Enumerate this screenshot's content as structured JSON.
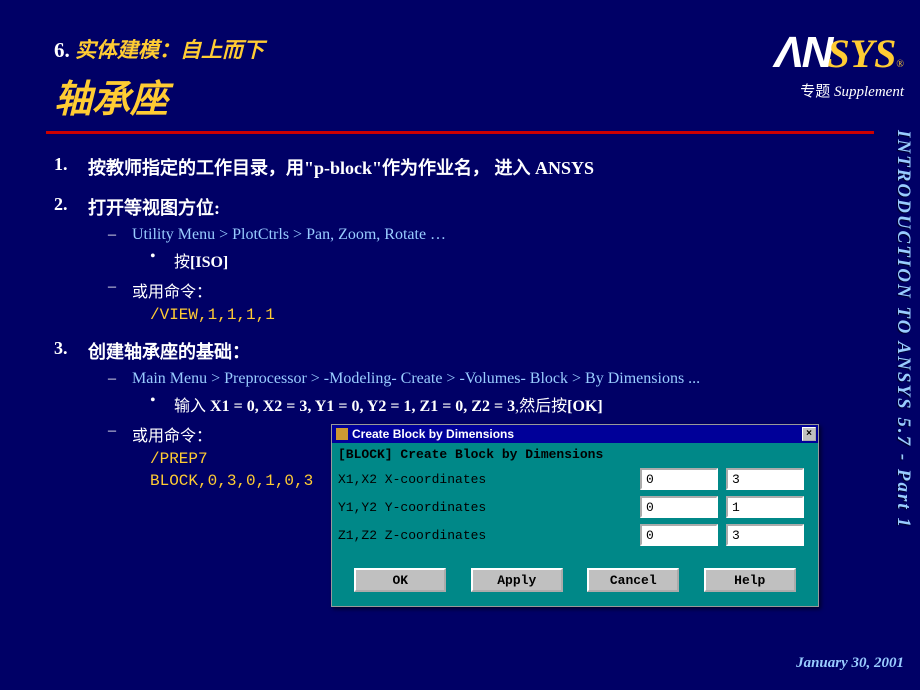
{
  "header": {
    "breadcrumb_num": "6.",
    "breadcrumb_text": "实体建模：自上而下",
    "title": "轴承座",
    "logo_n": "ΛN",
    "logo_sys": "SYS",
    "logo_reg": "®",
    "subtitle_zh": "专题",
    "subtitle_en": " Supplement"
  },
  "side_label": "INTRODUCTION TO ANSYS 5.7 - Part 1",
  "footer_date": "January 30, 2001",
  "steps": [
    {
      "num": "1.",
      "text_parts": [
        "按教师指定的工作目录，用\"",
        "p-block",
        "\"作为作业名， 进入 ",
        "ANSYS"
      ]
    },
    {
      "num": "2.",
      "text": "打开等视图方位:",
      "sub_link": "Utility Menu > PlotCtrls > Pan, Zoom, Rotate …",
      "bullet_prefix": "按",
      "bullet_bold": "[ISO]",
      "or_cmd": "或用命令：",
      "mono": "/VIEW,1,1,1,1"
    },
    {
      "num": "3.",
      "text": "创建轴承座的基础：",
      "sub_link": "Main Menu > Preprocessor > -Modeling- Create > -Volumes- Block > By Dimensions ...",
      "bullet_prefix": "输入 ",
      "bullet_bold": "X1 = 0, X2 = 3, Y1 = 0, Y2 = 1, Z1 = 0, Z2 = 3",
      "bullet_suffix": ",然后按",
      "bullet_bold2": "[OK]",
      "or_cmd": "或用命令：",
      "mono1": "/PREP7",
      "mono2": "BLOCK,0,3,0,1,0,3"
    }
  ],
  "dialog": {
    "title": "Create Block by Dimensions",
    "heading": "[BLOCK]  Create Block by Dimensions",
    "rows": [
      {
        "label": "X1,X2  X-coordinates",
        "v1": "0",
        "v2": "3"
      },
      {
        "label": "Y1,Y2  Y-coordinates",
        "v1": "0",
        "v2": "1"
      },
      {
        "label": "Z1,Z2  Z-coordinates",
        "v1": "0",
        "v2": "3"
      }
    ],
    "buttons": {
      "ok": "OK",
      "apply": "Apply",
      "cancel": "Cancel",
      "help": "Help"
    },
    "close": "×"
  }
}
